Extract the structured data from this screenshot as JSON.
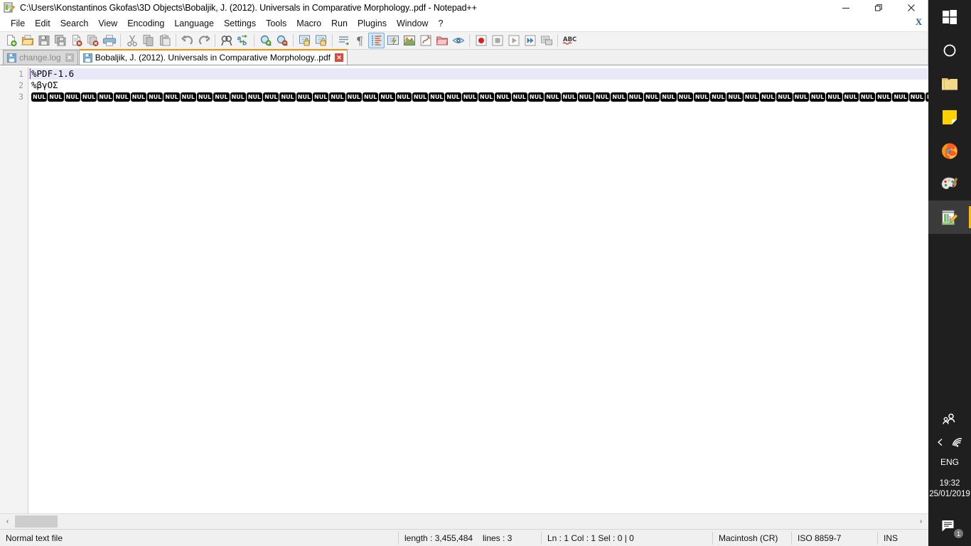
{
  "window": {
    "title": "C:\\Users\\Konstantinos Gkofas\\3D Objects\\Bobaljik, J. (2012). Universals in Comparative Morphology..pdf - Notepad++",
    "app_icon": "notepad-plus-plus-icon",
    "controls": {
      "minimize": "—",
      "restore": "❐",
      "close": "✕"
    }
  },
  "menu": {
    "items": [
      {
        "label": "File"
      },
      {
        "label": "Edit"
      },
      {
        "label": "Search"
      },
      {
        "label": "View"
      },
      {
        "label": "Encoding"
      },
      {
        "label": "Language"
      },
      {
        "label": "Settings"
      },
      {
        "label": "Tools"
      },
      {
        "label": "Macro"
      },
      {
        "label": "Run"
      },
      {
        "label": "Plugins"
      },
      {
        "label": "Window"
      },
      {
        "label": "?"
      }
    ],
    "close_document_label": "X"
  },
  "toolbar": {
    "buttons": [
      {
        "name": "new-file-icon",
        "title": "New"
      },
      {
        "name": "open-file-icon",
        "title": "Open"
      },
      {
        "name": "save-icon",
        "title": "Save"
      },
      {
        "name": "save-all-icon",
        "title": "Save All"
      },
      {
        "name": "close-file-icon",
        "title": "Close"
      },
      {
        "name": "close-all-files-icon",
        "title": "Close All"
      },
      {
        "name": "print-icon",
        "title": "Print"
      },
      {
        "sep": true
      },
      {
        "name": "cut-icon",
        "title": "Cut"
      },
      {
        "name": "copy-icon",
        "title": "Copy"
      },
      {
        "name": "paste-icon",
        "title": "Paste"
      },
      {
        "sep": true
      },
      {
        "name": "undo-icon",
        "title": "Undo"
      },
      {
        "name": "redo-icon",
        "title": "Redo"
      },
      {
        "sep": true
      },
      {
        "name": "find-icon",
        "title": "Find"
      },
      {
        "name": "replace-icon",
        "title": "Replace"
      },
      {
        "sep": true
      },
      {
        "name": "zoom-in-icon",
        "title": "Zoom In"
      },
      {
        "name": "zoom-out-icon",
        "title": "Zoom Out"
      },
      {
        "sep": true
      },
      {
        "name": "sync-vertical-scroll-icon",
        "title": "Synchronize Vertical Scrolling"
      },
      {
        "name": "sync-horizontal-scroll-icon",
        "title": "Synchronize Horizontal Scrolling"
      },
      {
        "sep": true
      },
      {
        "name": "word-wrap-icon",
        "title": "Word wrap"
      },
      {
        "name": "show-all-characters-icon",
        "title": "Show All Characters"
      },
      {
        "name": "indent-guideline-icon",
        "title": "Show Indent Guide"
      },
      {
        "name": "user-defined-dialog-icon",
        "title": "Show UDL dialog"
      },
      {
        "name": "document-map-icon",
        "title": "Document Map"
      },
      {
        "name": "function-list-icon",
        "title": "Function List"
      },
      {
        "name": "folder-as-workspace-icon",
        "title": "Folder as Workspace"
      },
      {
        "name": "monitoring-icon",
        "title": "Monitoring"
      },
      {
        "sep": true
      },
      {
        "name": "macro-record-icon",
        "title": "Start Recording"
      },
      {
        "name": "macro-stop-icon",
        "title": "Stop Recording"
      },
      {
        "name": "macro-play-icon",
        "title": "Playback"
      },
      {
        "name": "macro-run-multiple-icon",
        "title": "Run a Macro Multiple Times"
      },
      {
        "name": "macro-save-icon",
        "title": "Save Current Recorded Macro"
      },
      {
        "sep": true
      },
      {
        "name": "spell-check-icon",
        "title": "ABC"
      }
    ]
  },
  "tabs": [
    {
      "label": "change.log",
      "active": false,
      "icon": "saved-file-icon",
      "close": "✕"
    },
    {
      "label": "Bobaljik, J. (2012). Universals in Comparative Morphology..pdf",
      "active": true,
      "icon": "saved-file-icon",
      "close": "✕"
    }
  ],
  "editor": {
    "line_numbers": [
      "1",
      "2",
      "3"
    ],
    "lines": [
      {
        "text": "%PDF-1.6",
        "current": true,
        "type": "text"
      },
      {
        "text": "%βγΟΣ",
        "current": false,
        "type": "text"
      },
      {
        "text": "NUL",
        "current": false,
        "type": "nul-run",
        "count": 76
      }
    ]
  },
  "hscroll": {
    "left_arrow": "‹",
    "right_arrow": "›"
  },
  "statusbar": {
    "file_type": "Normal text file",
    "length_label": "length : 3,455,484",
    "lines_label": "lines : 3",
    "position": "Ln : 1    Col : 1    Sel : 0 | 0",
    "eol": "Macintosh (CR)",
    "encoding": "ISO 8859-7",
    "insert_mode": "INS"
  },
  "taskbar": {
    "items": [
      {
        "name": "start-button-icon",
        "label": "Start",
        "running": false
      },
      {
        "name": "cortana-search-icon",
        "label": "Cortana",
        "running": false
      },
      {
        "name": "file-explorer-icon",
        "label": "File Explorer",
        "running": false
      },
      {
        "name": "sticky-notes-icon",
        "label": "Sticky Notes",
        "running": false
      },
      {
        "name": "firefox-icon",
        "label": "Firefox",
        "running": false
      },
      {
        "name": "paint-icon",
        "label": "Paint",
        "running": false
      },
      {
        "name": "notepad-plus-plus-taskbar-icon",
        "label": "Notepad++",
        "running": true
      }
    ],
    "tray": {
      "people_icon": "people-icon",
      "show_hidden_icons": "‹",
      "network_icon": "wifi-icon",
      "language": "ENG",
      "time": "19:32",
      "date": "25/01/2019",
      "action_center_icon": "action-center-icon",
      "action_center_badge": "1"
    }
  },
  "colors": {
    "tab_active_accent": "#ff8c00",
    "current_line_highlight": "#e8e8f8",
    "caret": "#6a3fa0",
    "taskbar_bg": "#1f1f1f",
    "running_indicator": "#ffb900",
    "statusbar_bg": "#f0f0f0"
  }
}
